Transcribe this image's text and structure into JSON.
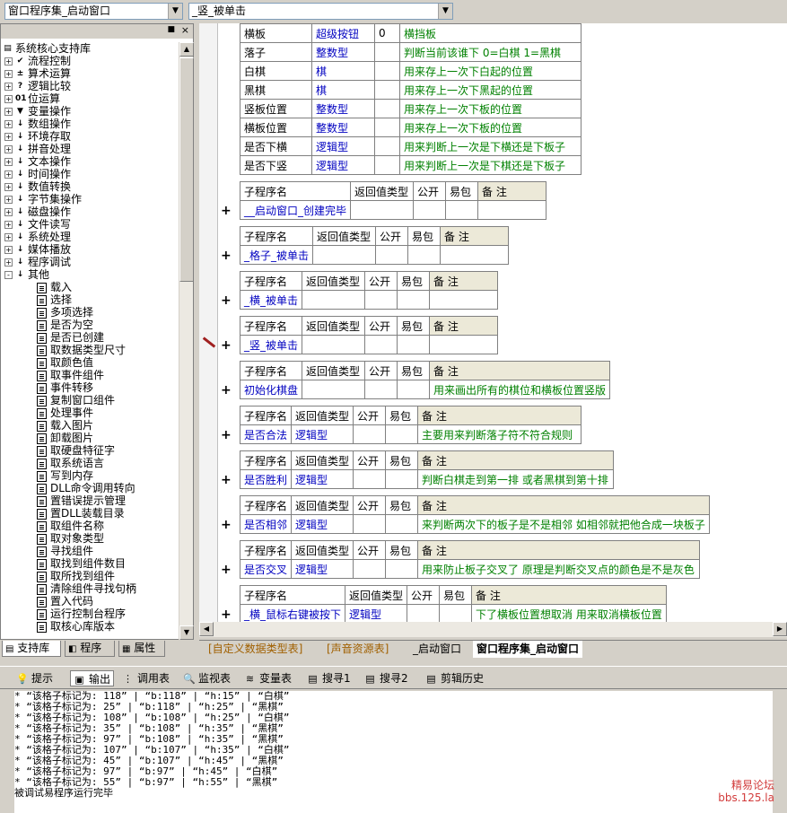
{
  "window_combo": "窗口程序集_启动窗口",
  "method_combo": "_竖_被单击",
  "left_panel": {
    "tree": [
      {
        "label": "系统核心支持库",
        "level": 0,
        "icon": "library-icon",
        "expand": "-"
      },
      {
        "label": "流程控制",
        "level": 1,
        "icon": "flow-icon",
        "expand": "+"
      },
      {
        "label": "算术运算",
        "level": 1,
        "icon": "math-icon",
        "expand": "+"
      },
      {
        "label": "逻辑比较",
        "level": 1,
        "icon": "question-icon",
        "expand": "+"
      },
      {
        "label": "位运算",
        "level": 1,
        "icon": "bit-icon",
        "expand": "+"
      },
      {
        "label": "变量操作",
        "level": 1,
        "icon": "var-icon",
        "expand": "+"
      },
      {
        "label": "数组操作",
        "level": 1,
        "icon": "cmd-icon",
        "expand": "+"
      },
      {
        "label": "环境存取",
        "level": 1,
        "icon": "cmd-icon",
        "expand": "+"
      },
      {
        "label": "拼音处理",
        "level": 1,
        "icon": "cmd-icon",
        "expand": "+"
      },
      {
        "label": "文本操作",
        "level": 1,
        "icon": "cmd-icon",
        "expand": "+"
      },
      {
        "label": "时间操作",
        "level": 1,
        "icon": "cmd-icon",
        "expand": "+"
      },
      {
        "label": "数值转换",
        "level": 1,
        "icon": "cmd-icon",
        "expand": "+"
      },
      {
        "label": "字节集操作",
        "level": 1,
        "icon": "cmd-icon",
        "expand": "+"
      },
      {
        "label": "磁盘操作",
        "level": 1,
        "icon": "cmd-icon",
        "expand": "+"
      },
      {
        "label": "文件读写",
        "level": 1,
        "icon": "cmd-icon",
        "expand": "+"
      },
      {
        "label": "系统处理",
        "level": 1,
        "icon": "cmd-icon",
        "expand": "+"
      },
      {
        "label": "媒体播放",
        "level": 1,
        "icon": "cmd-icon",
        "expand": "+"
      },
      {
        "label": "程序调试",
        "level": 1,
        "icon": "cmd-icon",
        "expand": "+"
      },
      {
        "label": "其他",
        "level": 1,
        "icon": "cmd-icon",
        "expand": "-"
      },
      {
        "label": "载入",
        "level": 2
      },
      {
        "label": "选择",
        "level": 2
      },
      {
        "label": "多项选择",
        "level": 2
      },
      {
        "label": "是否为空",
        "level": 2
      },
      {
        "label": "是否已创建",
        "level": 2
      },
      {
        "label": "取数据类型尺寸",
        "level": 2
      },
      {
        "label": "取颜色值",
        "level": 2
      },
      {
        "label": "取事件组件",
        "level": 2
      },
      {
        "label": "事件转移",
        "level": 2
      },
      {
        "label": "复制窗口组件",
        "level": 2
      },
      {
        "label": "处理事件",
        "level": 2
      },
      {
        "label": "载入图片",
        "level": 2
      },
      {
        "label": "卸载图片",
        "level": 2
      },
      {
        "label": "取硬盘特征字",
        "level": 2
      },
      {
        "label": "取系统语言",
        "level": 2
      },
      {
        "label": "写到内存",
        "level": 2
      },
      {
        "label": "DLL命令调用转向",
        "level": 2
      },
      {
        "label": "置错误提示管理",
        "level": 2
      },
      {
        "label": "置DLL装载目录",
        "level": 2
      },
      {
        "label": "取组件名称",
        "level": 2
      },
      {
        "label": "取对象类型",
        "level": 2
      },
      {
        "label": "寻找组件",
        "level": 2
      },
      {
        "label": "取找到组件数目",
        "level": 2
      },
      {
        "label": "取所找到组件",
        "level": 2
      },
      {
        "label": "清除组件寻找句柄",
        "level": 2
      },
      {
        "label": "置入代码",
        "level": 2
      },
      {
        "label": "运行控制台程序",
        "level": 2
      },
      {
        "label": "取核心库版本",
        "level": 2
      }
    ],
    "tabs": [
      "支持库",
      "程序",
      "属性"
    ]
  },
  "variables": [
    {
      "name": "横板",
      "type": "超级按钮",
      "arr": "0",
      "note": "横挡板"
    },
    {
      "name": "落子",
      "type": "整数型",
      "arr": "",
      "note": "判断当前该谁下  0=白棋  1=黑棋"
    },
    {
      "name": "白棋",
      "type": "棋",
      "arr": "",
      "note": "用来存上一次下白起的位置"
    },
    {
      "name": "黑棋",
      "type": "棋",
      "arr": "",
      "note": "用来存上一次下黑起的位置"
    },
    {
      "name": "竖板位置",
      "type": "整数型",
      "arr": "",
      "note": "用来存上一次下板的位置"
    },
    {
      "name": "横板位置",
      "type": "整数型",
      "arr": "",
      "note": "用来存上一次下板的位置"
    },
    {
      "name": "是否下横",
      "type": "逻辑型",
      "arr": "",
      "note": "用来判断上一次是下横还是下板子"
    },
    {
      "name": "是否下竖",
      "type": "逻辑型",
      "arr": "",
      "note": "用来判断上一次是下棋还是下板子"
    }
  ],
  "sub_header": {
    "name": "子程序名",
    "ret": "返回值类型",
    "pub": "公开",
    "easy": "易包",
    "note": "备 注"
  },
  "subs": [
    {
      "name": "__启动窗口_创建完毕",
      "ret": "",
      "note": ""
    },
    {
      "name": "_格子_被单击",
      "ret": "",
      "note": ""
    },
    {
      "name": "_横_被单击",
      "ret": "",
      "note": ""
    },
    {
      "name": "_竖_被单击",
      "ret": "",
      "note": ""
    },
    {
      "name": "初始化棋盘",
      "ret": "",
      "note": "用来画出所有的棋位和横板位置竖版"
    },
    {
      "name": "是否合法",
      "ret": "逻辑型",
      "note": "主要用来判断落子符不符合规则"
    },
    {
      "name": "是否胜利",
      "ret": "逻辑型",
      "note": "判断白棋走到第一排  或者黑棋到第十排"
    },
    {
      "name": "是否相邻",
      "ret": "逻辑型",
      "note": "来判断两次下的板子是不是相邻  如相邻就把他合成一块板子"
    },
    {
      "name": "是否交叉",
      "ret": "逻辑型",
      "note": "用来防止板子交叉了  原理是判断交叉点的颜色是不是灰色"
    },
    {
      "name": "_横_鼠标右键被按下",
      "ret": "逻辑型",
      "note": "下了横板位置想取消  用来取消横板位置"
    }
  ],
  "file_tabs": [
    "[自定义数据类型表]",
    "[声音资源表]",
    "_启动窗口",
    "窗口程序集_启动窗口"
  ],
  "bottom_tabs": [
    "提示",
    "输出",
    "调用表",
    "监视表",
    "变量表",
    "搜寻1",
    "搜寻2",
    "剪辑历史"
  ],
  "output_lines": [
    "* “该格子标记为: 118” | “b:118” | “h:15” | “白棋”",
    "* “该格子标记为: 25” | “b:118” | “h:25” | “黑棋”",
    "* “该格子标记为: 108” | “b:108” | “h:25” | “白棋”",
    "* “该格子标记为: 35” | “b:108” | “h:35” | “黑棋”",
    "* “该格子标记为: 97” | “b:108” | “h:35” | “黑棋”",
    "* “该格子标记为: 107” | “b:107” | “h:35” | “白棋”",
    "* “该格子标记为: 45” | “b:107” | “h:45” | “黑棋”",
    "* “该格子标记为: 97” | “b:97” | “h:45” | “白棋”",
    "* “该格子标记为: 55” | “b:97” | “h:55” | “黑棋”",
    "被调试易程序运行完毕"
  ],
  "watermark": {
    "line1": "精易论坛",
    "line2": "bbs.125.la"
  },
  "colors": {
    "keyword": "#0000c0",
    "comment": "#008000",
    "panel": "#d4d0c8"
  }
}
